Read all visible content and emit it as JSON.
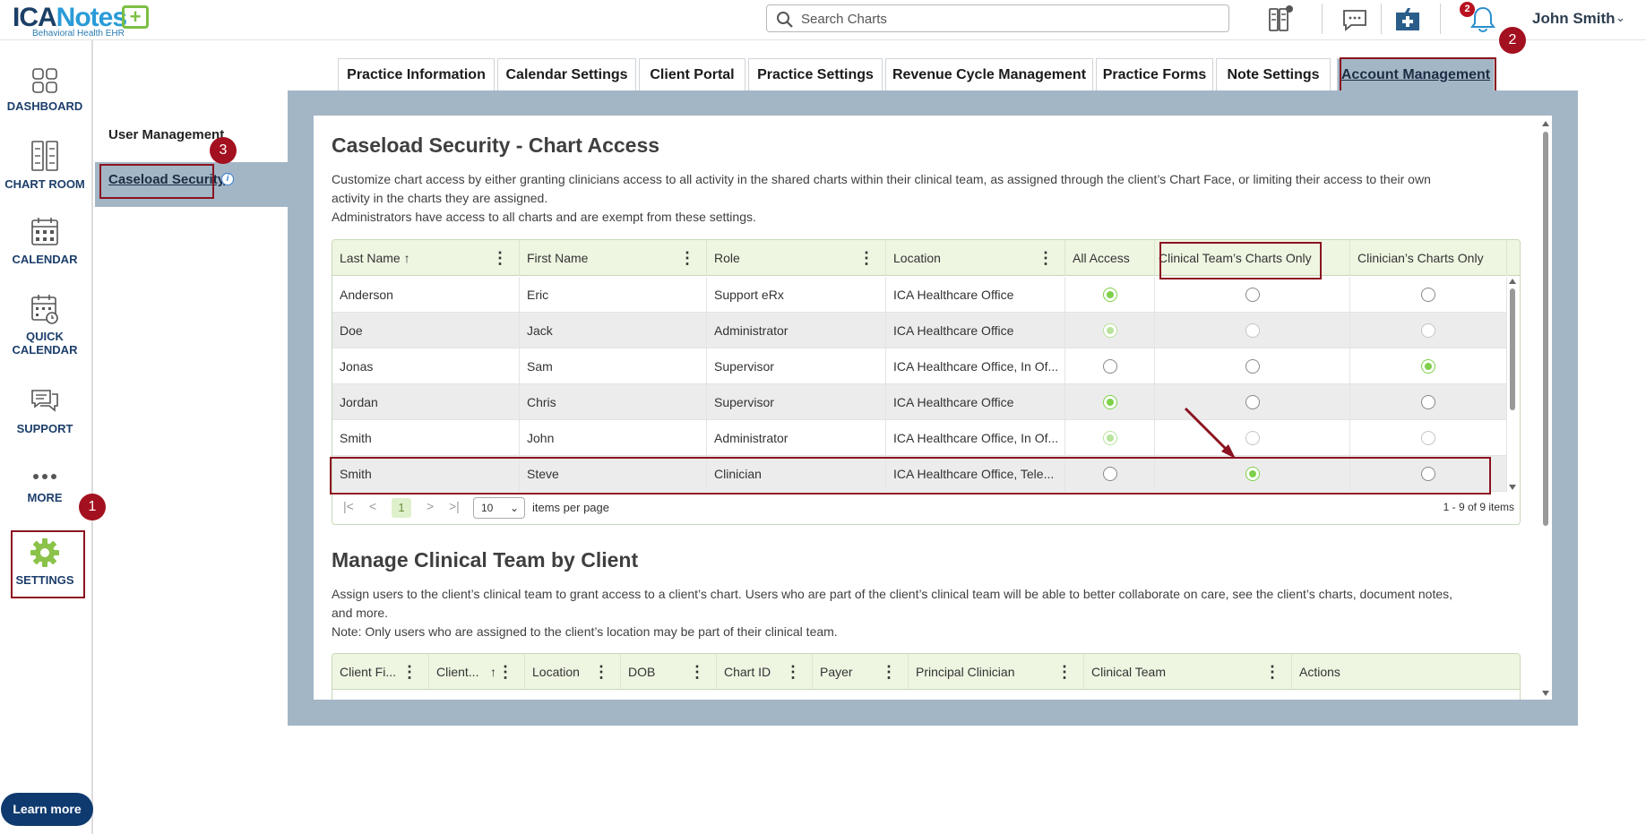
{
  "header": {
    "logo": {
      "brand_a": "ICA",
      "brand_b": "Notes",
      "plus": "+",
      "tagline": "Behavioral Health EHR"
    },
    "search": {
      "placeholder": "Search Charts"
    },
    "icons": [
      "charts-icon",
      "messages-icon",
      "rx-icon",
      "bell-icon"
    ],
    "notifications_count": "2",
    "user_name": "John Smith",
    "user_chevron": "⌄"
  },
  "sidebar": {
    "items": [
      {
        "label": "DASHBOARD",
        "icon": "dashboard-icon"
      },
      {
        "label": "CHART ROOM",
        "icon": "chart-room-icon"
      },
      {
        "label": "CALENDAR",
        "icon": "calendar-icon"
      },
      {
        "label": "QUICK",
        "label2": "CALENDAR",
        "icon": "quick-calendar-icon"
      },
      {
        "label": "SUPPORT",
        "icon": "support-icon"
      },
      {
        "label": "MORE",
        "icon": "more-icon"
      },
      {
        "label": "SETTINGS",
        "icon": "gear-icon"
      }
    ],
    "learn_more": "Learn more"
  },
  "subnav": {
    "user_management": "User Management",
    "caseload_security": "Caseload Security",
    "info": "i"
  },
  "tabs": [
    {
      "label": "Practice Information"
    },
    {
      "label": "Calendar Settings"
    },
    {
      "label": "Client Portal"
    },
    {
      "label": "Practice Settings"
    },
    {
      "label": "Revenue Cycle Management"
    },
    {
      "label": "Practice Forms"
    },
    {
      "label": "Note Settings"
    },
    {
      "label": "Account Management",
      "active": true
    }
  ],
  "steps": [
    "1",
    "2",
    "3"
  ],
  "caseload": {
    "title": "Caseload Security - Chart Access",
    "desc1": "Customize chart access by either granting clinicians access to all activity in the shared charts within their clinical team, as assigned through the client’s Chart Face, or limiting their access to their own",
    "desc2": "activity in the charts they are assigned.",
    "desc3": "Administrators have access to all charts and are exempt from these settings.",
    "columns": [
      "Last Name",
      "First Name",
      "Role",
      "Location",
      "All Access",
      "Clinical Team’s Charts Only",
      "Clinician’s Charts Only"
    ],
    "sort_arrow": "↑",
    "kebab": "⋮",
    "rows": [
      {
        "last": "Anderson",
        "first": "Eric",
        "role": "Support eRx",
        "location": "ICA Healthcare Office",
        "access": "all",
        "disabled": false
      },
      {
        "last": "Doe",
        "first": "Jack",
        "role": "Administrator",
        "location": "ICA Healthcare Office",
        "access": "all",
        "disabled": true
      },
      {
        "last": "Jonas",
        "first": "Sam",
        "role": "Supervisor",
        "location": "ICA Healthcare Office, In Of...",
        "access": "clinician",
        "disabled": false
      },
      {
        "last": "Jordan",
        "first": "Chris",
        "role": "Supervisor",
        "location": "ICA Healthcare Office",
        "access": "all",
        "disabled": false
      },
      {
        "last": "Smith",
        "first": "John",
        "role": "Administrator",
        "location": "ICA Healthcare Office, In Of...",
        "access": "all",
        "disabled": true
      },
      {
        "last": "Smith",
        "first": "Steve",
        "role": "Clinician",
        "location": "ICA Healthcare Office, Tele...",
        "access": "team",
        "disabled": false
      }
    ],
    "pager": {
      "first": "|<",
      "prev": "<",
      "page": "1",
      "next": ">",
      "last": ">|",
      "per_page": "10",
      "per_page_label": "items per page",
      "count": "1 - 9 of 9 items"
    }
  },
  "clinical_team": {
    "title": "Manage Clinical Team by Client",
    "desc1": "Assign users to the client’s clinical team to grant access to a client’s chart. Users who are part of the client’s clinical team will be able to better collaborate on care, see the client’s charts, document notes,",
    "desc2": "and more.",
    "desc3": "Note: Only users who are assigned to the client’s location may be part of their clinical team.",
    "columns": [
      "Client Fi...",
      "Client...",
      "Location",
      "DOB",
      "Chart ID",
      "Payer",
      "Principal Clinician",
      "Clinical Team",
      "Actions"
    ]
  },
  "colors": {
    "accent_green": "#7ed04a",
    "highlight_red": "#8b1220",
    "frame_blue": "#a3b6c6",
    "brand_navy": "#1b3f66"
  }
}
